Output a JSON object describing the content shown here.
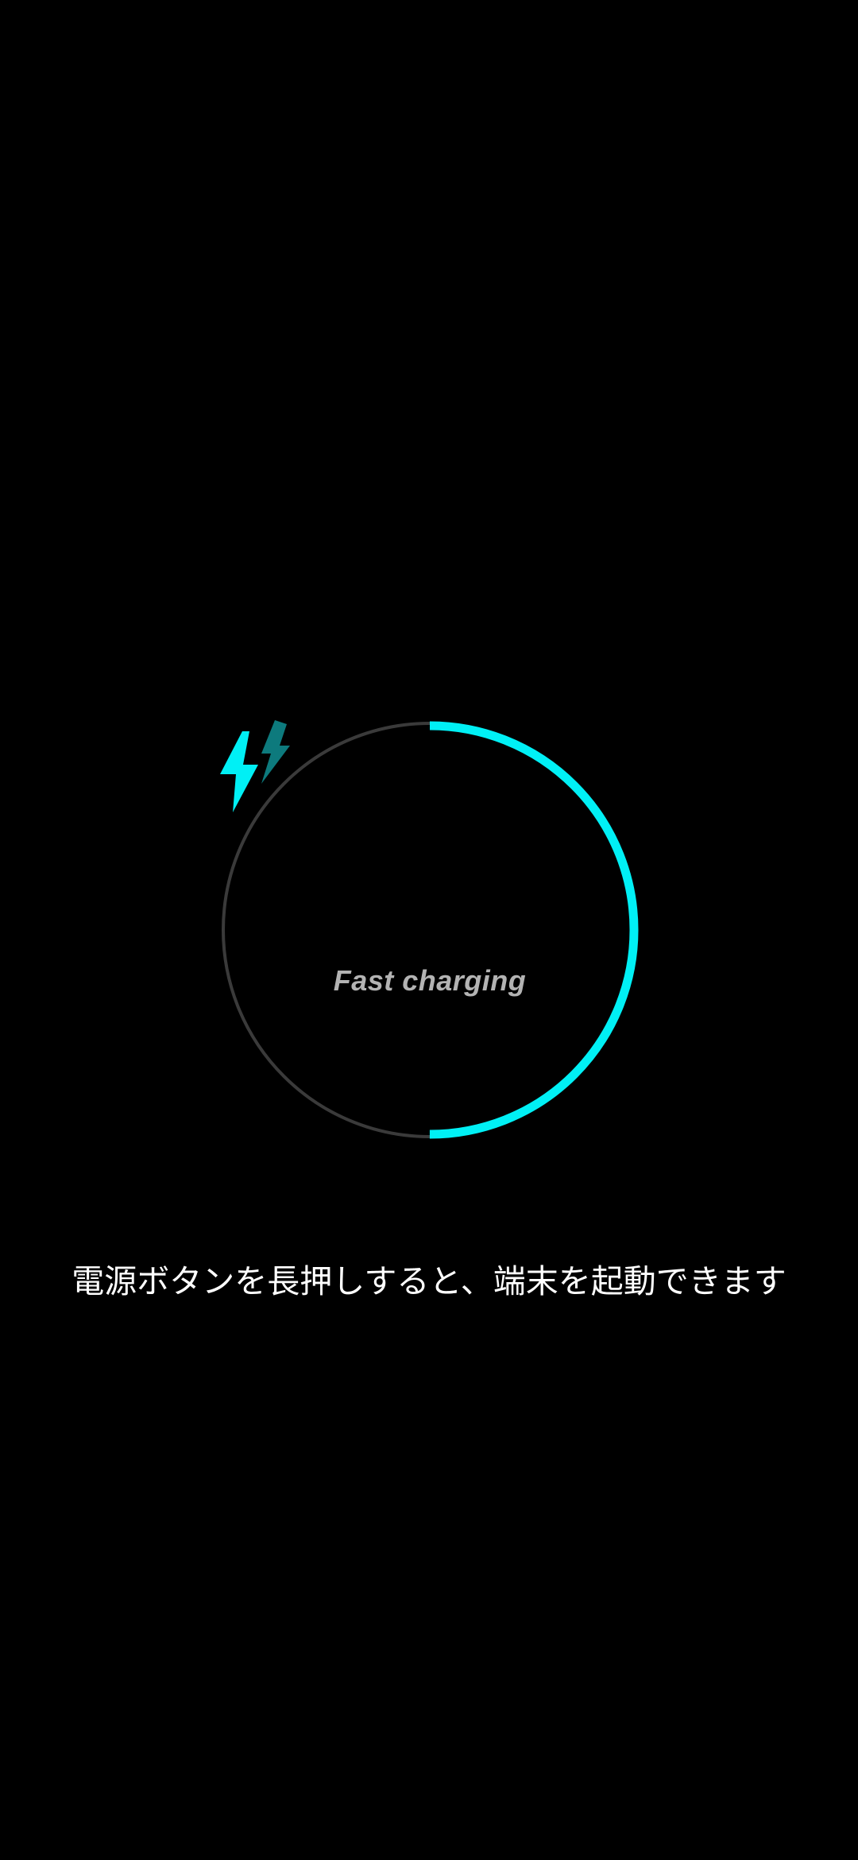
{
  "charging": {
    "status_label": "Fast charging",
    "level_fraction": 0.5,
    "progress_color": "#00f0f5",
    "track_color": "#3a3a3a",
    "icon": "fast-charging-bolt-icon"
  },
  "hint": {
    "text": "電源ボタンを長押しすると、端末を起動できます"
  }
}
